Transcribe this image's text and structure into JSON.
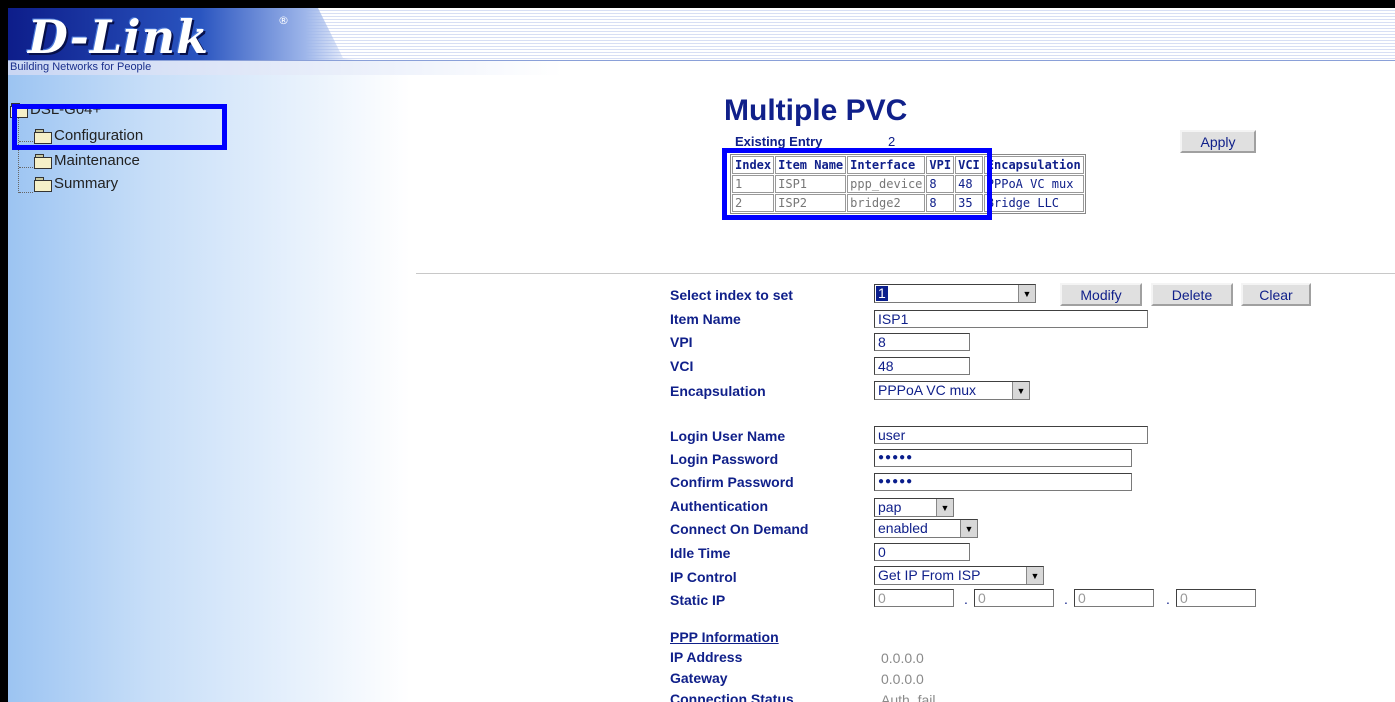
{
  "header": {
    "logo": "D-Link",
    "logo_reg": "®",
    "tagline": "Building Networks for People"
  },
  "sidebar": {
    "root_label": "DSL-G04+",
    "items": [
      {
        "label": "Configuration"
      },
      {
        "label": "Maintenance"
      },
      {
        "label": "Summary"
      }
    ]
  },
  "main": {
    "title": "Multiple PVC",
    "existing_label": "Existing Entry",
    "existing_count": "2",
    "apply_label": "Apply",
    "table": {
      "headers": [
        "Index",
        "Item Name",
        "Interface",
        "VPI",
        "VCI",
        "Encapsulation"
      ],
      "rows": [
        [
          "1",
          "ISP1",
          "ppp_device",
          "8",
          "48",
          "PPPoA VC mux"
        ],
        [
          "2",
          "ISP2",
          "bridge2",
          "8",
          "35",
          "Bridge LLC"
        ]
      ]
    },
    "form": {
      "select_index_label": "Select index to set",
      "select_index_value": "1",
      "modify_label": "Modify",
      "delete_label": "Delete",
      "clear_label": "Clear",
      "item_name_label": "Item Name",
      "item_name_value": "ISP1",
      "vpi_label": "VPI",
      "vpi_value": "8",
      "vci_label": "VCI",
      "vci_value": "48",
      "encapsulation_label": "Encapsulation",
      "encapsulation_value": "PPPoA VC mux",
      "login_user_label": "Login User Name",
      "login_user_value": "user",
      "login_password_label": "Login Password",
      "login_password_value": "●●●●●",
      "confirm_password_label": "Confirm Password",
      "confirm_password_value": "●●●●●",
      "authentication_label": "Authentication",
      "authentication_value": "pap",
      "connect_on_demand_label": "Connect On Demand",
      "connect_on_demand_value": "enabled",
      "idle_time_label": "Idle Time",
      "idle_time_value": "0",
      "ip_control_label": "IP Control",
      "ip_control_value": "Get IP From ISP",
      "static_ip_label": "Static IP",
      "static_ip": [
        "0",
        "0",
        "0",
        "0"
      ],
      "static_ip_sep": "."
    },
    "ppp": {
      "title": "PPP Information",
      "ip_address_label": "IP Address",
      "ip_address_value": "0.0.0.0",
      "gateway_label": "Gateway",
      "gateway_value": "0.0.0.0",
      "connection_status_label": "Connection Status",
      "connection_status_value": "Auth. fail"
    }
  },
  "colors": {
    "highlight": "#0000ff",
    "label_text": "#10208a"
  }
}
